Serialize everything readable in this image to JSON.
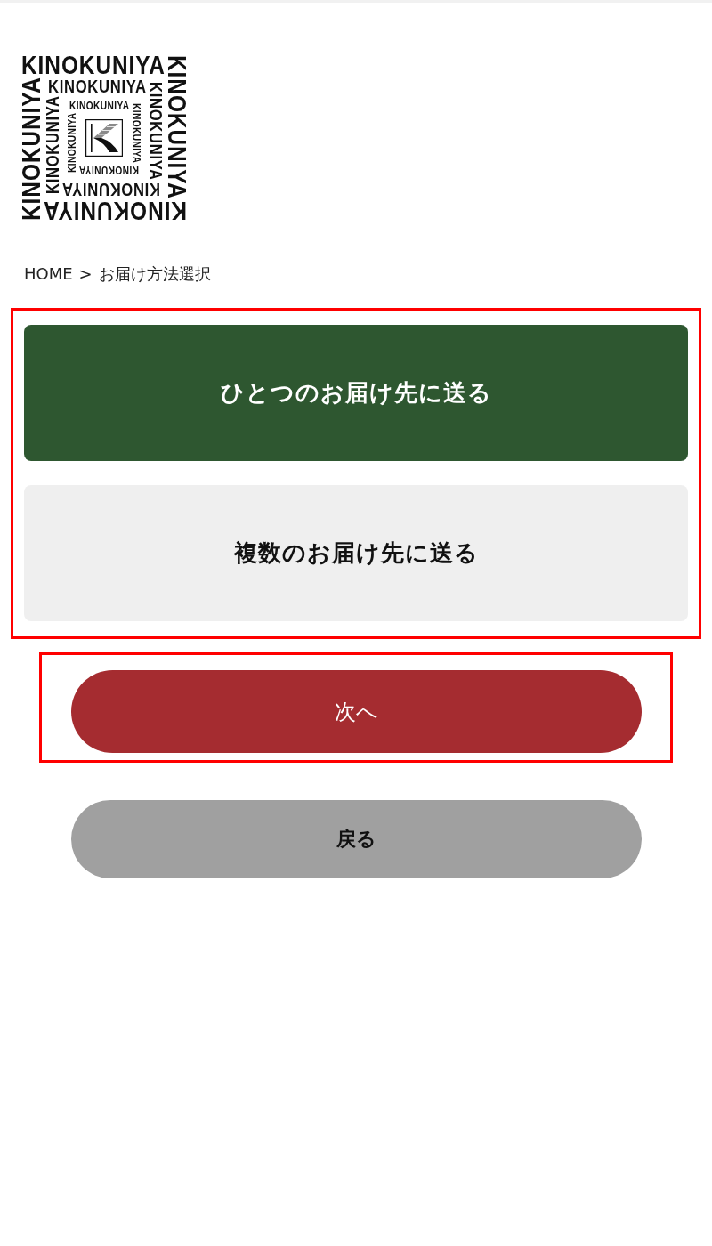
{
  "logo": {
    "rings": [
      {
        "sides": [
          "KINOKUNIYA",
          "KINOKUNIYA",
          "KINOKUNIYA",
          "KINOKUNIYA"
        ]
      },
      {
        "sides": [
          "KINOKUNIYA",
          "KINOKUNIYA",
          "KINOKUNIYA",
          "KINOKUNIYA"
        ]
      },
      {
        "sides": [
          "KINOKUNIYA",
          "KINOKUNIYA",
          "KINOKUNIYA",
          "KINOKUNIYA"
        ]
      }
    ]
  },
  "breadcrumb": {
    "items": [
      "HOME",
      "お届け方法選択"
    ],
    "separator": ">"
  },
  "delivery_options": {
    "highlighted": true,
    "items": [
      {
        "label": "ひとつのお届け先に送る",
        "selected": true
      },
      {
        "label": "複数のお届け先に送る",
        "selected": false
      }
    ]
  },
  "buttons": [
    {
      "kind": "primary",
      "label": "次へ",
      "highlighted": true
    },
    {
      "kind": "secondary",
      "label": "戻る",
      "highlighted": false
    }
  ]
}
